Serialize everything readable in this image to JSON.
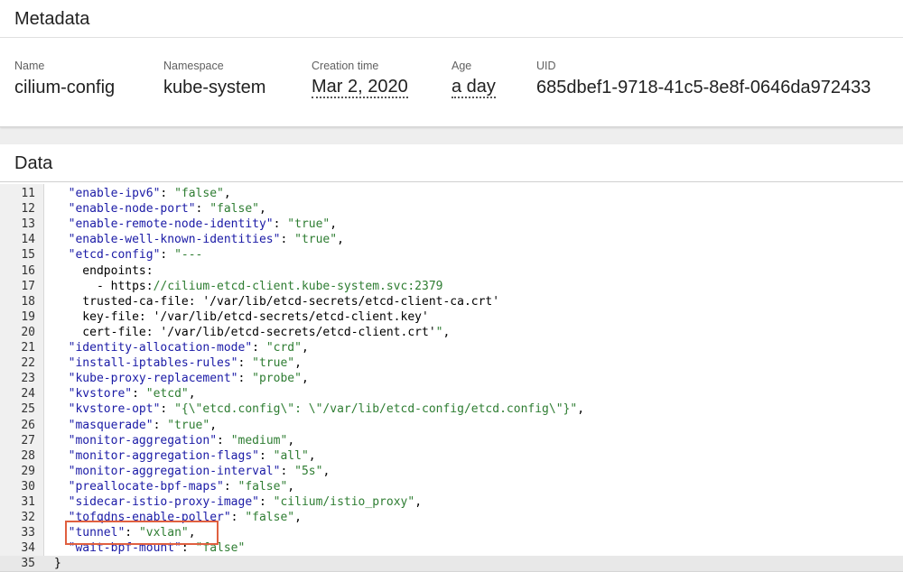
{
  "metadata": {
    "title": "Metadata",
    "fields": {
      "name": {
        "label": "Name",
        "value": "cilium-config"
      },
      "namespace": {
        "label": "Namespace",
        "value": "kube-system"
      },
      "creation_time": {
        "label": "Creation time",
        "value": "Mar 2, 2020"
      },
      "age": {
        "label": "Age",
        "value": "a day"
      },
      "uid": {
        "label": "UID",
        "value": "685dbef1-9718-41c5-8e8f-0646da972433"
      }
    }
  },
  "data": {
    "title": "Data",
    "lines": [
      {
        "n": "11",
        "parts": [
          [
            "p",
            "  "
          ],
          [
            "k",
            "\"enable-ipv6\""
          ],
          [
            "p",
            ": "
          ],
          [
            "s",
            "\"false\""
          ],
          [
            "p",
            ","
          ]
        ]
      },
      {
        "n": "12",
        "parts": [
          [
            "p",
            "  "
          ],
          [
            "k",
            "\"enable-node-port\""
          ],
          [
            "p",
            ": "
          ],
          [
            "s",
            "\"false\""
          ],
          [
            "p",
            ","
          ]
        ]
      },
      {
        "n": "13",
        "parts": [
          [
            "p",
            "  "
          ],
          [
            "k",
            "\"enable-remote-node-identity\""
          ],
          [
            "p",
            ": "
          ],
          [
            "s",
            "\"true\""
          ],
          [
            "p",
            ","
          ]
        ]
      },
      {
        "n": "14",
        "parts": [
          [
            "p",
            "  "
          ],
          [
            "k",
            "\"enable-well-known-identities\""
          ],
          [
            "p",
            ": "
          ],
          [
            "s",
            "\"true\""
          ],
          [
            "p",
            ","
          ]
        ]
      },
      {
        "n": "15",
        "parts": [
          [
            "p",
            "  "
          ],
          [
            "k",
            "\"etcd-config\""
          ],
          [
            "p",
            ": "
          ],
          [
            "s",
            "\"---"
          ]
        ]
      },
      {
        "n": "16",
        "parts": [
          [
            "p",
            "    endpoints:"
          ]
        ]
      },
      {
        "n": "17",
        "parts": [
          [
            "p",
            "      - https:"
          ],
          [
            "s",
            "//cilium-etcd-client.kube-system.svc:2379"
          ]
        ]
      },
      {
        "n": "18",
        "parts": [
          [
            "p",
            "    trusted-ca-file: '/var/lib/etcd-secrets/etcd-client-ca.crt'"
          ]
        ]
      },
      {
        "n": "19",
        "parts": [
          [
            "p",
            "    key-file: '/var/lib/etcd-secrets/etcd-client.key'"
          ]
        ]
      },
      {
        "n": "20",
        "parts": [
          [
            "p",
            "    cert-file: '/var/lib/etcd-secrets/etcd-client.crt'"
          ],
          [
            "s",
            "\""
          ],
          [
            "p",
            ","
          ]
        ]
      },
      {
        "n": "21",
        "parts": [
          [
            "p",
            "  "
          ],
          [
            "k",
            "\"identity-allocation-mode\""
          ],
          [
            "p",
            ": "
          ],
          [
            "s",
            "\"crd\""
          ],
          [
            "p",
            ","
          ]
        ]
      },
      {
        "n": "22",
        "parts": [
          [
            "p",
            "  "
          ],
          [
            "k",
            "\"install-iptables-rules\""
          ],
          [
            "p",
            ": "
          ],
          [
            "s",
            "\"true\""
          ],
          [
            "p",
            ","
          ]
        ]
      },
      {
        "n": "23",
        "parts": [
          [
            "p",
            "  "
          ],
          [
            "k",
            "\"kube-proxy-replacement\""
          ],
          [
            "p",
            ": "
          ],
          [
            "s",
            "\"probe\""
          ],
          [
            "p",
            ","
          ]
        ]
      },
      {
        "n": "24",
        "parts": [
          [
            "p",
            "  "
          ],
          [
            "k",
            "\"kvstore\""
          ],
          [
            "p",
            ": "
          ],
          [
            "s",
            "\"etcd\""
          ],
          [
            "p",
            ","
          ]
        ]
      },
      {
        "n": "25",
        "parts": [
          [
            "p",
            "  "
          ],
          [
            "k",
            "\"kvstore-opt\""
          ],
          [
            "p",
            ": "
          ],
          [
            "s",
            "\"{\\\"etcd.config\\\": \\\"/var/lib/etcd-config/etcd.config\\\"}\""
          ],
          [
            "p",
            ","
          ]
        ]
      },
      {
        "n": "26",
        "parts": [
          [
            "p",
            "  "
          ],
          [
            "k",
            "\"masquerade\""
          ],
          [
            "p",
            ": "
          ],
          [
            "s",
            "\"true\""
          ],
          [
            "p",
            ","
          ]
        ]
      },
      {
        "n": "27",
        "parts": [
          [
            "p",
            "  "
          ],
          [
            "k",
            "\"monitor-aggregation\""
          ],
          [
            "p",
            ": "
          ],
          [
            "s",
            "\"medium\""
          ],
          [
            "p",
            ","
          ]
        ]
      },
      {
        "n": "28",
        "parts": [
          [
            "p",
            "  "
          ],
          [
            "k",
            "\"monitor-aggregation-flags\""
          ],
          [
            "p",
            ": "
          ],
          [
            "s",
            "\"all\""
          ],
          [
            "p",
            ","
          ]
        ]
      },
      {
        "n": "29",
        "parts": [
          [
            "p",
            "  "
          ],
          [
            "k",
            "\"monitor-aggregation-interval\""
          ],
          [
            "p",
            ": "
          ],
          [
            "s",
            "\"5s\""
          ],
          [
            "p",
            ","
          ]
        ]
      },
      {
        "n": "30",
        "parts": [
          [
            "p",
            "  "
          ],
          [
            "k",
            "\"preallocate-bpf-maps\""
          ],
          [
            "p",
            ": "
          ],
          [
            "s",
            "\"false\""
          ],
          [
            "p",
            ","
          ]
        ]
      },
      {
        "n": "31",
        "parts": [
          [
            "p",
            "  "
          ],
          [
            "k",
            "\"sidecar-istio-proxy-image\""
          ],
          [
            "p",
            ": "
          ],
          [
            "s",
            "\"cilium/istio_proxy\""
          ],
          [
            "p",
            ","
          ]
        ]
      },
      {
        "n": "32",
        "parts": [
          [
            "p",
            "  "
          ],
          [
            "k",
            "\"tofqdns-enable-poller\""
          ],
          [
            "p",
            ": "
          ],
          [
            "s",
            "\"false\""
          ],
          [
            "p",
            ","
          ]
        ]
      },
      {
        "n": "33",
        "parts": [
          [
            "p",
            "  "
          ],
          [
            "k",
            "\"tunnel\""
          ],
          [
            "p",
            ": "
          ],
          [
            "s",
            "\"vxlan\""
          ],
          [
            "p",
            ","
          ]
        ]
      },
      {
        "n": "34",
        "parts": [
          [
            "p",
            "  "
          ],
          [
            "k",
            "\"wait-bpf-mount\""
          ],
          [
            "p",
            ": "
          ],
          [
            "s",
            "\"false\""
          ]
        ]
      },
      {
        "n": "35",
        "parts": [
          [
            "p",
            "}"
          ]
        ]
      }
    ]
  },
  "colors": {
    "key": "#1a1aa6",
    "string": "#2e7d32",
    "highlight_box": "#e06040"
  }
}
